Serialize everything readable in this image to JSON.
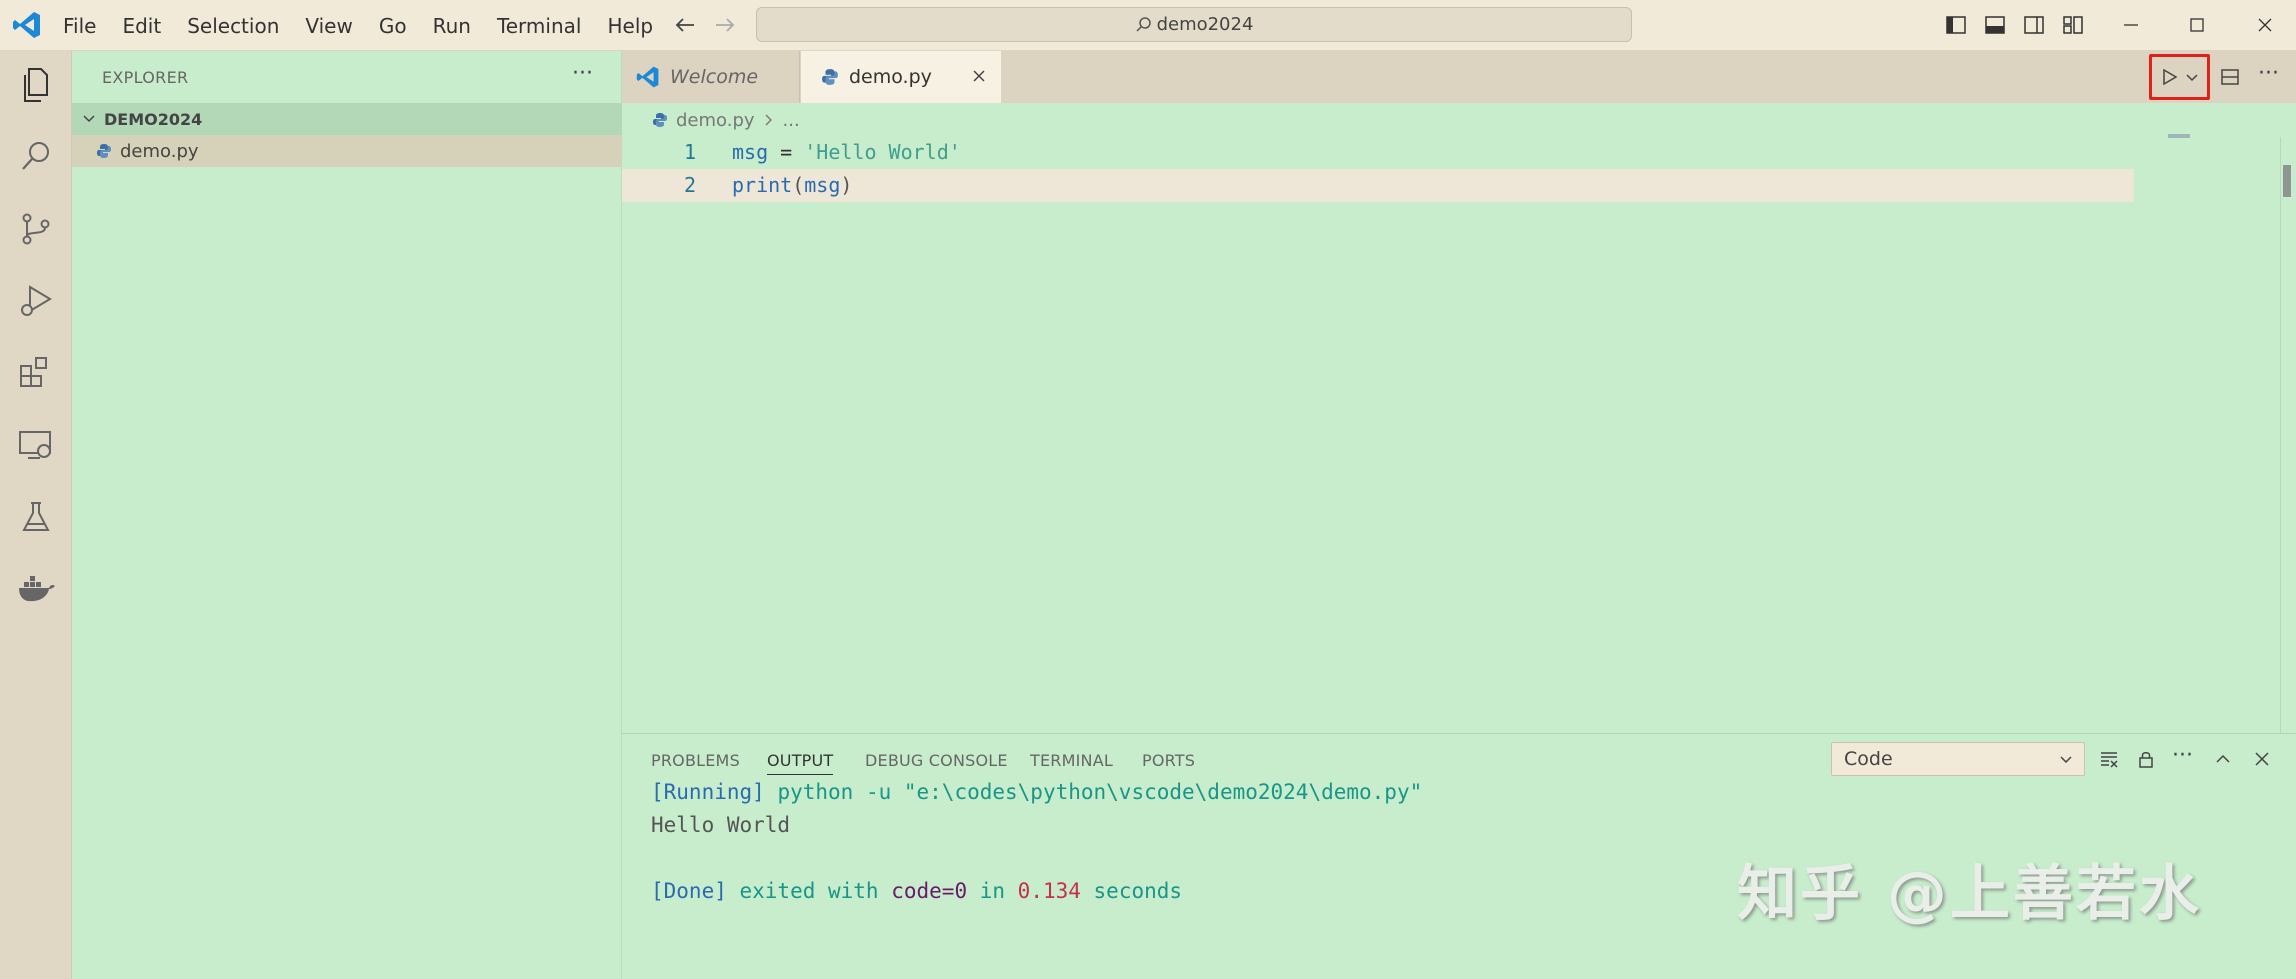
{
  "menu": [
    "File",
    "Edit",
    "Selection",
    "View",
    "Go",
    "Run",
    "Terminal",
    "Help"
  ],
  "command_center": {
    "text": "demo2024"
  },
  "sidebar": {
    "title": "EXPLORER",
    "more": "···",
    "folder": "DEMO2024",
    "file": "demo.py"
  },
  "tabs": {
    "welcome": "Welcome",
    "active": "demo.py"
  },
  "breadcrumb": {
    "file": "demo.py",
    "rest": "..."
  },
  "code": {
    "line1": {
      "num": "1",
      "var": "msg",
      "op": " = ",
      "str": "'Hello World'"
    },
    "line2": {
      "num": "2",
      "fn": "print",
      "open": "(",
      "arg": "msg",
      "close": ")"
    }
  },
  "panel": {
    "tabs": [
      "PROBLEMS",
      "OUTPUT",
      "DEBUG CONSOLE",
      "TERMINAL",
      "PORTS"
    ],
    "active_tab": "OUTPUT",
    "channel": "Code",
    "more": "···",
    "running_tag": "[Running]",
    "running_cmd": " python -u \"e:\\codes\\python\\vscode\\demo2024\\demo.py\"",
    "output": "Hello World",
    "done_tag": "[Done]",
    "done_1": " exited with ",
    "done_code": "code=0",
    "done_2": " in ",
    "done_time": "0.134",
    "done_3": " seconds"
  },
  "editor_more": "···",
  "watermark": "知乎 @上善若水",
  "colors": {
    "background": "#c7edcc",
    "titlebar": "#f1ead9",
    "highlight_box": "#e0201a",
    "accent": "#007acc"
  }
}
